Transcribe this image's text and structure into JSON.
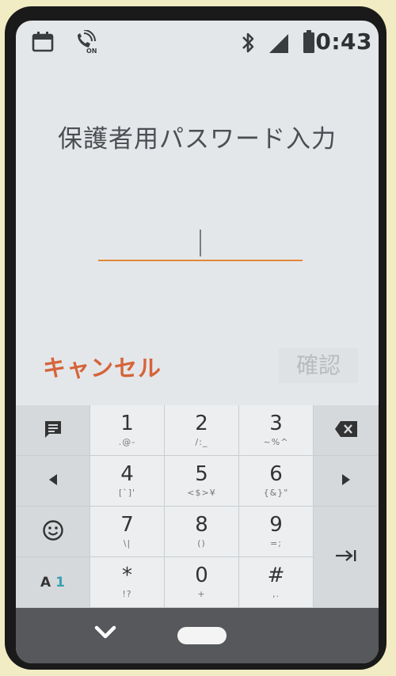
{
  "status_bar": {
    "time": "0:43",
    "icons": [
      "calendar-icon",
      "wifi-calling-on-icon",
      "bluetooth-icon",
      "signal-icon",
      "battery-icon"
    ]
  },
  "dialog": {
    "title": "保護者用パスワード入力",
    "cancel_label": "キャンセル",
    "confirm_label": "確認"
  },
  "keyboard": {
    "keys": {
      "k1": {
        "main": "1",
        "sub": ".@-"
      },
      "k2": {
        "main": "2",
        "sub": "/:_"
      },
      "k3": {
        "main": "3",
        "sub": "~%^"
      },
      "k4": {
        "main": "4",
        "sub": "[`]'"
      },
      "k5": {
        "main": "5",
        "sub": "<$>¥"
      },
      "k6": {
        "main": "6",
        "sub": "{&}\""
      },
      "k7": {
        "main": "7",
        "sub": "\\|"
      },
      "k8": {
        "main": "8",
        "sub": "()"
      },
      "k9": {
        "main": "9",
        "sub": "=;"
      },
      "kstar": {
        "main": "*",
        "sub": "!?"
      },
      "k0": {
        "main": "0",
        "sub": "+"
      },
      "khash": {
        "main": "#",
        "sub": ",."
      }
    },
    "mode_label": {
      "letter": "A",
      "digit": "1"
    }
  },
  "colors": {
    "accent": "#d5643a",
    "underline": "#e0883a",
    "mode_digit": "#3aa0b0"
  }
}
